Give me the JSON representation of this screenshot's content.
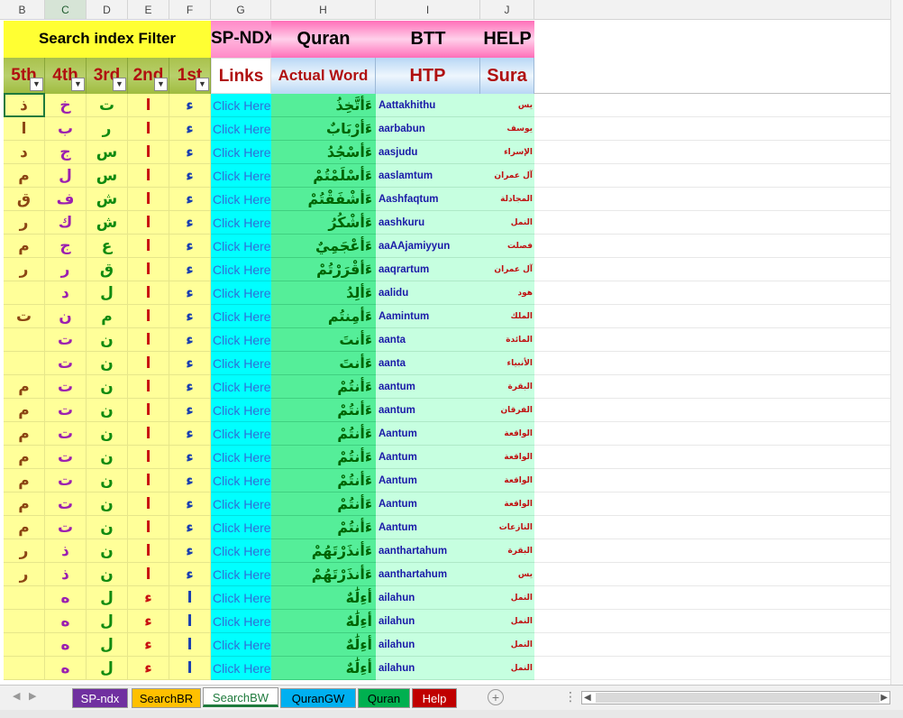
{
  "columns": {
    "B": "B",
    "C": "C",
    "D": "D",
    "E": "E",
    "F": "F",
    "G": "G",
    "H": "H",
    "I": "I",
    "J": "J"
  },
  "header1": {
    "filter_title": "Search index Filter",
    "spndx": "SP-NDX",
    "quran": "Quran",
    "btt": "BTT",
    "help": "HELP"
  },
  "header2": {
    "fifth": "5th",
    "fourth": "4th",
    "third": "3rd",
    "second": "2nd",
    "first": "1st",
    "links": "Links",
    "actual_word": "Actual Word",
    "htp": "HTP",
    "sura": "Sura"
  },
  "link_label": "Click Here",
  "rows": [
    {
      "b": "ذ",
      "c": "خ",
      "d": "ت",
      "e": "ا",
      "f": "ء",
      "word": "ءَأتَّخِذُ",
      "htp": "Aattakhithu",
      "sura": "يس"
    },
    {
      "b": "ا",
      "c": "ب",
      "d": "ر",
      "e": "ا",
      "f": "ء",
      "word": "ءَأرْبَابٌ",
      "htp": "aarbabun",
      "sura": "يوسف"
    },
    {
      "b": "د",
      "c": "ج",
      "d": "س",
      "e": "ا",
      "f": "ء",
      "word": "ءَأسْجُدُ",
      "htp": "aasjudu",
      "sura": "الإسراء"
    },
    {
      "b": "م",
      "c": "ل",
      "d": "س",
      "e": "ا",
      "f": "ء",
      "word": "ءَأسْلَمْتُمْ",
      "htp": "aaslamtum",
      "sura": "آل عمران"
    },
    {
      "b": "ق",
      "c": "ف",
      "d": "ش",
      "e": "ا",
      "f": "ء",
      "word": "ءَأشْفَقْتُمْ",
      "htp": "Aashfaqtum",
      "sura": "المجادلة"
    },
    {
      "b": "ر",
      "c": "ك",
      "d": "ش",
      "e": "ا",
      "f": "ء",
      "word": "ءَأشْكُرُ",
      "htp": "aashkuru",
      "sura": "النمل"
    },
    {
      "b": "م",
      "c": "ج",
      "d": "ع",
      "e": "ا",
      "f": "ء",
      "word": "ءَأعْجَمِيٌ",
      "htp": "aaAAjamiyyun",
      "sura": "فصلت"
    },
    {
      "b": "ر",
      "c": "ر",
      "d": "ق",
      "e": "ا",
      "f": "ء",
      "word": "ءَأقْرَرْتُمْ",
      "htp": "aaqrartum",
      "sura": "آل عمران"
    },
    {
      "b": "",
      "c": "د",
      "d": "ل",
      "e": "ا",
      "f": "ء",
      "word": "ءَألِدُ",
      "htp": "aalidu",
      "sura": "هود"
    },
    {
      "b": "ت",
      "c": "ن",
      "d": "م",
      "e": "ا",
      "f": "ء",
      "word": "ءَأمِنتُم",
      "htp": "Aamintum",
      "sura": "الملك"
    },
    {
      "b": "",
      "c": "ت",
      "d": "ن",
      "e": "ا",
      "f": "ء",
      "word": "ءَأنتَ",
      "htp": "aanta",
      "sura": "المائدة"
    },
    {
      "b": "",
      "c": "ت",
      "d": "ن",
      "e": "ا",
      "f": "ء",
      "word": "ءَأنتَ",
      "htp": "aanta",
      "sura": "الأنبياء"
    },
    {
      "b": "م",
      "c": "ت",
      "d": "ن",
      "e": "ا",
      "f": "ء",
      "word": "ءَأنتُمْ",
      "htp": "aantum",
      "sura": "البقرة"
    },
    {
      "b": "م",
      "c": "ت",
      "d": "ن",
      "e": "ا",
      "f": "ء",
      "word": "ءَأنتُمْ",
      "htp": "aantum",
      "sura": "الفرقان"
    },
    {
      "b": "م",
      "c": "ت",
      "d": "ن",
      "e": "ا",
      "f": "ء",
      "word": "ءَأنتُمْ",
      "htp": "Aantum",
      "sura": "الواقعة"
    },
    {
      "b": "م",
      "c": "ت",
      "d": "ن",
      "e": "ا",
      "f": "ء",
      "word": "ءَأنتُمْ",
      "htp": "Aantum",
      "sura": "الواقعة"
    },
    {
      "b": "م",
      "c": "ت",
      "d": "ن",
      "e": "ا",
      "f": "ء",
      "word": "ءَأنتُمْ",
      "htp": "Aantum",
      "sura": "الواقعة"
    },
    {
      "b": "م",
      "c": "ت",
      "d": "ن",
      "e": "ا",
      "f": "ء",
      "word": "ءَأنتُمْ",
      "htp": "Aantum",
      "sura": "الواقعة"
    },
    {
      "b": "م",
      "c": "ت",
      "d": "ن",
      "e": "ا",
      "f": "ء",
      "word": "ءَأنتُمْ",
      "htp": "Aantum",
      "sura": "النازعات"
    },
    {
      "b": "ر",
      "c": "ذ",
      "d": "ن",
      "e": "ا",
      "f": "ء",
      "word": "ءَأنذَرْتَهُمْ",
      "htp": "aanthartahum",
      "sura": "البقرة"
    },
    {
      "b": "ر",
      "c": "ذ",
      "d": "ن",
      "e": "ا",
      "f": "ء",
      "word": "ءَأنذَرْتَهُمْ",
      "htp": "aanthartahum",
      "sura": "يس"
    },
    {
      "b": "",
      "c": "ه",
      "d": "ل",
      "e": "ء",
      "f": "ا",
      "word": "أءِلَٰهٌ",
      "htp": "ailahun",
      "sura": "النمل"
    },
    {
      "b": "",
      "c": "ه",
      "d": "ل",
      "e": "ء",
      "f": "ا",
      "word": "أءِلَٰهٌ",
      "htp": "ailahun",
      "sura": "النمل"
    },
    {
      "b": "",
      "c": "ه",
      "d": "ل",
      "e": "ء",
      "f": "ا",
      "word": "أءِلَٰهٌ",
      "htp": "ailahun",
      "sura": "النمل"
    },
    {
      "b": "",
      "c": "ه",
      "d": "ل",
      "e": "ء",
      "f": "ا",
      "word": "أءِلَٰهٌ",
      "htp": "ailahun",
      "sura": "النمل"
    }
  ],
  "tabs": [
    {
      "label": "SP-ndx",
      "bg": "#7030a0",
      "fg": "#ffffff"
    },
    {
      "label": "SearchBR",
      "bg": "#ffc000",
      "fg": "#000000"
    },
    {
      "label": "SearchBW",
      "bg": "#ffffff",
      "fg": "#1e7a3c"
    },
    {
      "label": "QuranGW",
      "bg": "#00b0f0",
      "fg": "#000000"
    },
    {
      "label": "Quran",
      "bg": "#00b050",
      "fg": "#000000"
    },
    {
      "label": "Help",
      "bg": "#c00000",
      "fg": "#ffffff"
    }
  ],
  "icons": {
    "add_sheet": "plus-circle-icon",
    "scroll_left": "triangle-left-icon",
    "scroll_right": "triangle-right-icon",
    "dropdown": "triangle-down-icon"
  }
}
